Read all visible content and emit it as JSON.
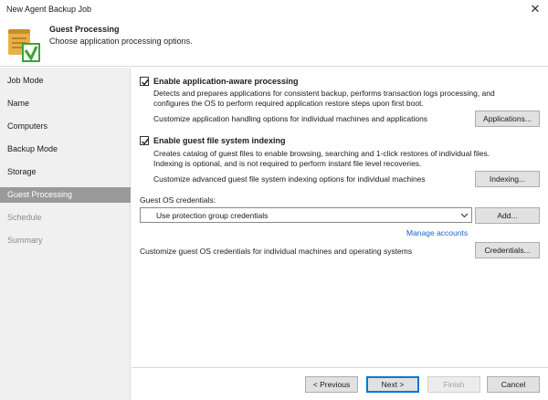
{
  "window": {
    "title": "New Agent Backup Job",
    "close_label": "✕"
  },
  "header": {
    "icon": "scroll-check-icon",
    "title": "Guest Processing",
    "subtitle": "Choose application processing options."
  },
  "sidebar": {
    "items": [
      {
        "label": "Job Mode",
        "state": "normal"
      },
      {
        "label": "Name",
        "state": "normal"
      },
      {
        "label": "Computers",
        "state": "normal"
      },
      {
        "label": "Backup Mode",
        "state": "normal"
      },
      {
        "label": "Storage",
        "state": "normal"
      },
      {
        "label": "Guest Processing",
        "state": "active"
      },
      {
        "label": "Schedule",
        "state": "disabled"
      },
      {
        "label": "Summary",
        "state": "disabled"
      }
    ]
  },
  "app_aware": {
    "checked": true,
    "label": "Enable application-aware processing",
    "description_line1": "Detects and prepares applications for consistent backup, performs transaction logs processing, and",
    "description_line2": "configures the OS to perform required application restore steps upon first boot.",
    "customize_text": "Customize application handling options for individual machines and applications",
    "button_label": "Applications..."
  },
  "indexing": {
    "checked": true,
    "label": "Enable guest file system indexing",
    "description_line1": "Creates catalog of guest files to enable browsing, searching and 1-click restores of individual files.",
    "description_line2": "Indexing is optional, and is not required to perform instant file level recoveries.",
    "customize_text": "Customize advanced guest file system indexing options for individual machines",
    "button_label": "Indexing..."
  },
  "credentials": {
    "section_label": "Guest OS credentials:",
    "selected_value": "Use protection group credentials",
    "add_button_label": "Add...",
    "manage_link": "Manage accounts",
    "customize_text": "Customize guest OS credentials for individual machines and operating systems",
    "button_label": "Credentials..."
  },
  "footer": {
    "previous_label": "< Previous",
    "next_label": "Next >",
    "finish_label": "Finish",
    "cancel_label": "Cancel"
  },
  "colors": {
    "accent": "#0078d7",
    "link": "#1a64c8",
    "active_nav": "#9a9a9a",
    "sidebar_bg": "#f0f0f0"
  }
}
